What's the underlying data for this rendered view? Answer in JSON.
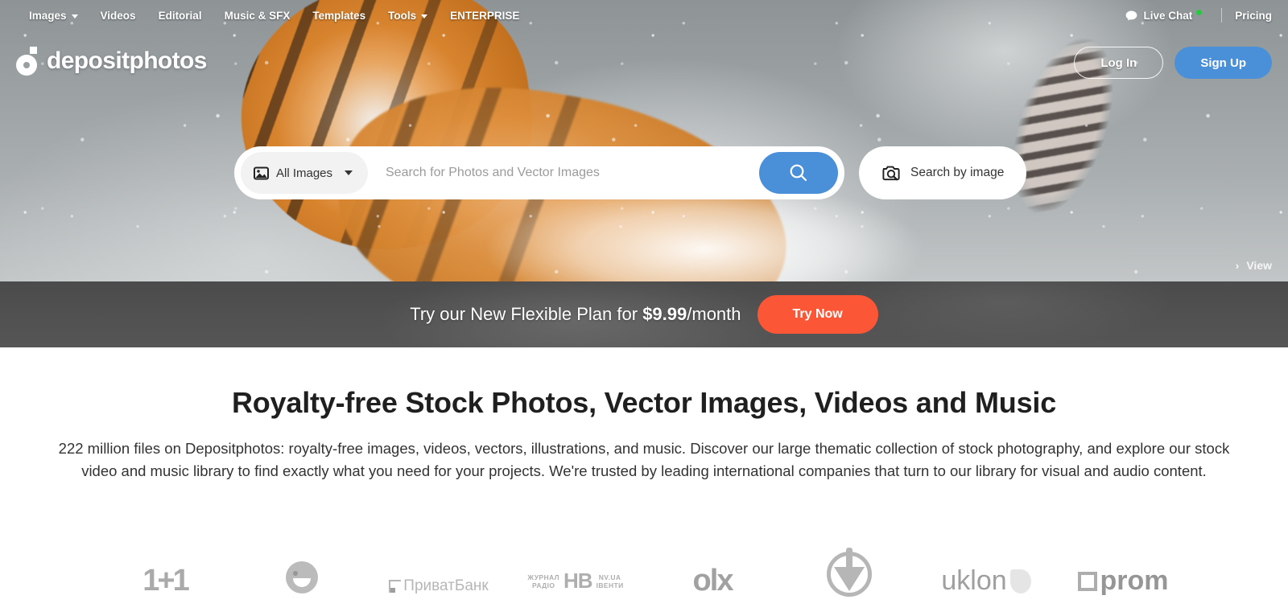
{
  "topnav": {
    "items": [
      {
        "label": "Images",
        "has_caret": true
      },
      {
        "label": "Videos",
        "has_caret": false
      },
      {
        "label": "Editorial",
        "has_caret": false
      },
      {
        "label": "Music & SFX",
        "has_caret": false
      },
      {
        "label": "Templates",
        "has_caret": false
      },
      {
        "label": "Tools",
        "has_caret": true
      },
      {
        "label": "ENTERPRISE",
        "has_caret": false
      }
    ],
    "live_chat": "Live Chat",
    "live_chat_status_color": "#27c93f",
    "pricing": "Pricing"
  },
  "brand": {
    "name": "depositphotos"
  },
  "auth": {
    "login": "Log In",
    "signup": "Sign Up"
  },
  "search": {
    "category_selected": "All Images",
    "placeholder": "Search for Photos and Vector Images",
    "value": "",
    "search_by_image": "Search by image",
    "search_button_color": "#4a90d9"
  },
  "hero": {
    "view_label": "View",
    "view_chevron": "›"
  },
  "promo": {
    "prefix": "Try our New Flexible Plan for ",
    "price": "$9.99",
    "suffix": "/month",
    "cta": "Try Now",
    "cta_color": "#fb5636"
  },
  "main": {
    "heading": "Royalty-free Stock Photos, Vector Images, Videos and Music",
    "paragraph": "222 million files on Depositphotos: royalty-free images, videos, vectors, illustrations, and music. Discover our large thematic collection of stock photography, and explore our stock video and music library to find exactly what you need for your projects. We're trusted by leading international companies that turn to our library for visual and audio content."
  },
  "client_logos": [
    {
      "name": "1+1",
      "text": "1+1"
    },
    {
      "name": "smile",
      "text": ""
    },
    {
      "name": "privatbank",
      "text": "ПриватБанк"
    },
    {
      "name": "nv",
      "text_top": "ЖУРНАЛ",
      "text_bottom": "РАДІО",
      "text_big": "НВ",
      "text_right_top": "NV.UA",
      "text_right_bottom": "ІВЕНТИ"
    },
    {
      "name": "olx",
      "text": "olx"
    },
    {
      "name": "shield",
      "text": ""
    },
    {
      "name": "uklon",
      "text": "uklon"
    },
    {
      "name": "prom",
      "text": "prom"
    }
  ]
}
